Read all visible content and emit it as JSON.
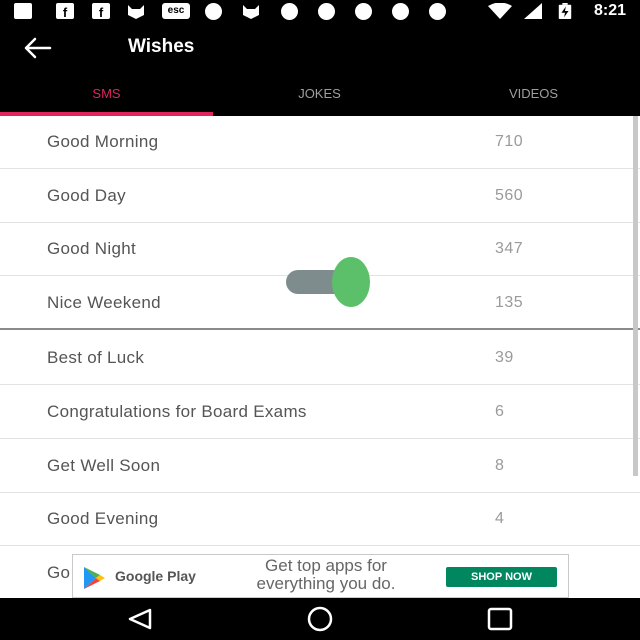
{
  "status_bar": {
    "time": "8:21",
    "left_icons": [
      "chat-icon",
      "facebook-icon",
      "facebook-icon",
      "cat-icon",
      "esc-icon",
      "pinterest-icon",
      "cat-icon",
      "pinterest-icon",
      "pinterest-icon",
      "pinterest-icon",
      "pinterest-icon",
      "pinterest-icon"
    ],
    "esc_label": "esc",
    "right_icons": [
      "wifi-icon",
      "signal-icon",
      "battery-charging-icon"
    ]
  },
  "app_bar": {
    "title": "Wishes",
    "back_icon": "arrow-left-icon"
  },
  "tabs": [
    {
      "label": "SMS",
      "active": true
    },
    {
      "label": "JOKES",
      "active": false
    },
    {
      "label": "VIDEOS",
      "active": false
    }
  ],
  "list": [
    {
      "label": "Good Morning",
      "count": "710"
    },
    {
      "label": "Good Day",
      "count": "560"
    },
    {
      "label": "Good Night",
      "count": "347"
    },
    {
      "label": "Nice Weekend",
      "count": "135"
    },
    {
      "label": "Best of Luck",
      "count": "39"
    },
    {
      "label": "Congratulations for Board Exams",
      "count": "6"
    },
    {
      "label": "Get Well Soon",
      "count": "8"
    },
    {
      "label": "Good Evening",
      "count": "4"
    },
    {
      "label": "Go",
      "count": ""
    }
  ],
  "toggle": {
    "on": true
  },
  "ad": {
    "brand": "Google Play",
    "text": "Get top apps for everything you do.",
    "cta": "SHOP NOW"
  },
  "nav_bar": {
    "icons": [
      "back-triangle-icon",
      "home-circle-icon",
      "recents-square-icon"
    ]
  },
  "colors": {
    "accent": "#e0245e",
    "toggle_knob": "#5cc06a",
    "toggle_track": "#7e8c8d",
    "cta": "#01875f"
  }
}
